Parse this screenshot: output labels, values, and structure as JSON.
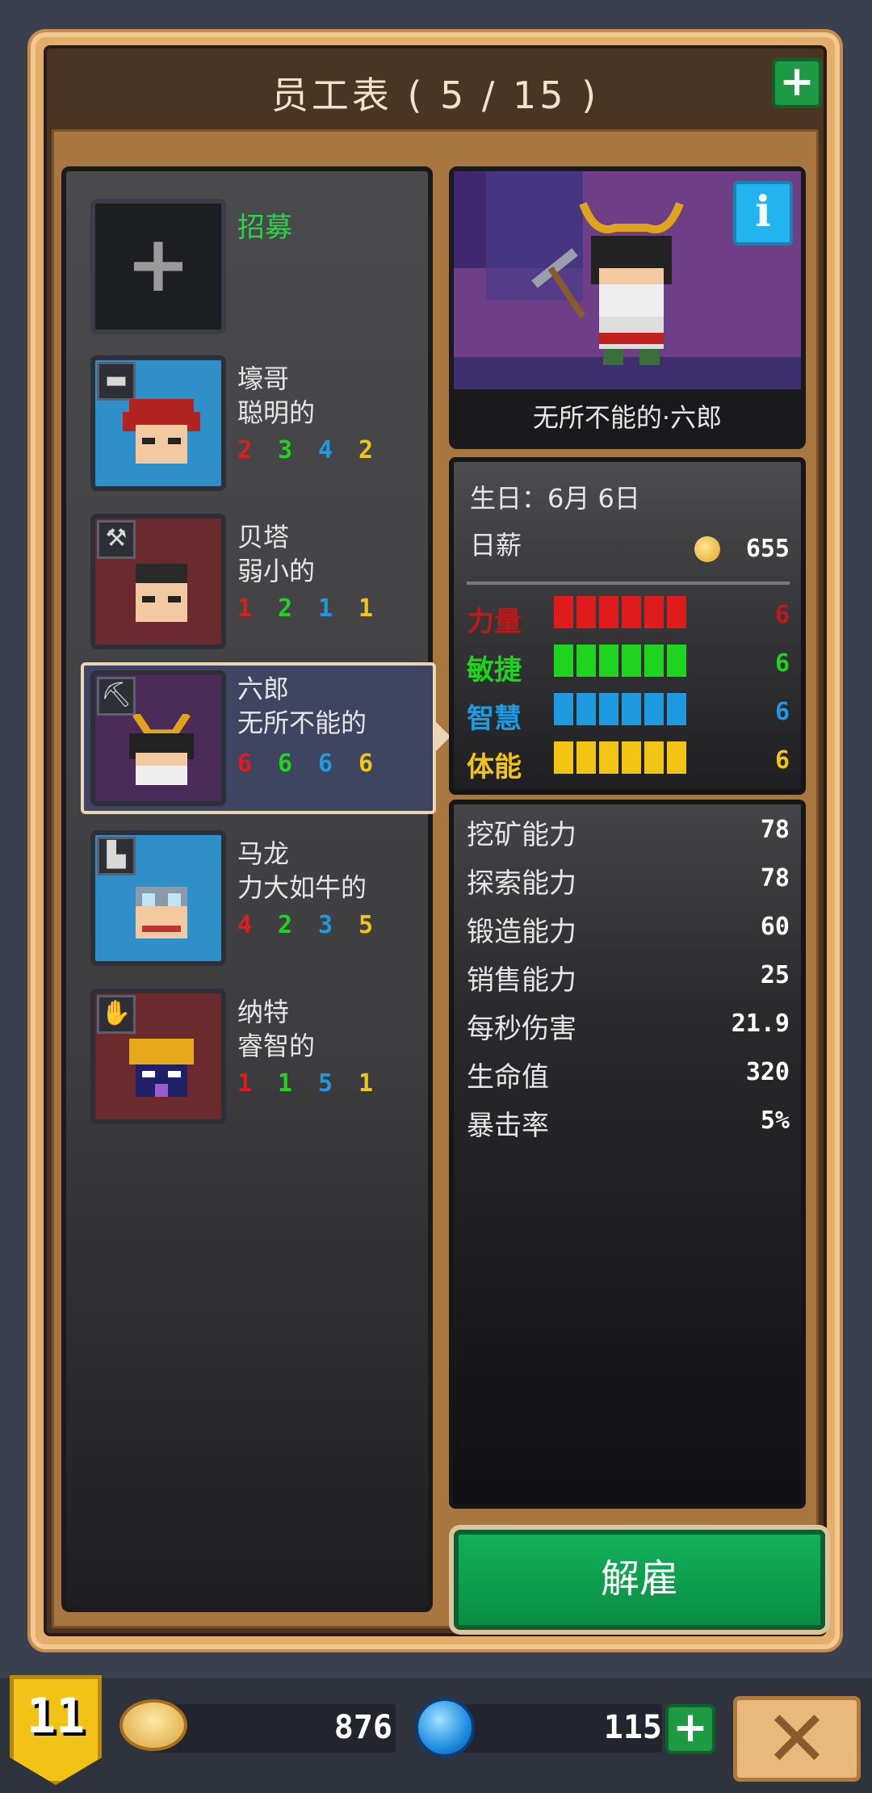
{
  "header": {
    "title": "员工表 ( 5 / 15 )"
  },
  "recruit": {
    "label": "招募",
    "icon": "plus-icon"
  },
  "employees": [
    {
      "name": "壕哥",
      "trait": "聪明的",
      "role_icon": "bed-icon",
      "stats": [
        "2",
        "3",
        "4",
        "2"
      ]
    },
    {
      "name": "贝塔",
      "trait": "弱小的",
      "role_icon": "hammer-icon",
      "stats": [
        "1",
        "2",
        "1",
        "1"
      ]
    },
    {
      "name": "六郎",
      "trait": "无所不能的",
      "role_icon": "pickaxe-icon",
      "stats": [
        "6",
        "6",
        "6",
        "6"
      ],
      "selected": true
    },
    {
      "name": "马龙",
      "trait": "力大如牛的",
      "role_icon": "boot-icon",
      "stats": [
        "4",
        "2",
        "3",
        "5"
      ]
    },
    {
      "name": "纳特",
      "trait": "睿智的",
      "role_icon": "hand-icon",
      "stats": [
        "1",
        "1",
        "5",
        "1"
      ]
    }
  ],
  "detail": {
    "character_name": "无所不能的·六郎",
    "birthday": "生日：6月 6日",
    "salary_label": "日薪",
    "salary_value": "655",
    "attributes": [
      {
        "label": "力量",
        "value": "6",
        "level": 6,
        "color": "#e01b1b"
      },
      {
        "label": "敏捷",
        "value": "6",
        "level": 6,
        "color": "#1ed41e"
      },
      {
        "label": "智慧",
        "value": "6",
        "level": 6,
        "color": "#1f9ae0"
      },
      {
        "label": "体能",
        "value": "6",
        "level": 6,
        "color": "#f2c514"
      }
    ],
    "abilities": [
      {
        "label": "挖矿能力",
        "value": "78"
      },
      {
        "label": "探索能力",
        "value": "78"
      },
      {
        "label": "锻造能力",
        "value": "60"
      },
      {
        "label": "销售能力",
        "value": "25"
      },
      {
        "label": "每秒伤害",
        "value": "21.9"
      },
      {
        "label": "生命值",
        "value": "320"
      },
      {
        "label": "暴击率",
        "value": "5%"
      }
    ]
  },
  "fire_button": {
    "label": "解雇"
  },
  "resources": {
    "level": "11",
    "gold": "876",
    "gems": "115"
  }
}
